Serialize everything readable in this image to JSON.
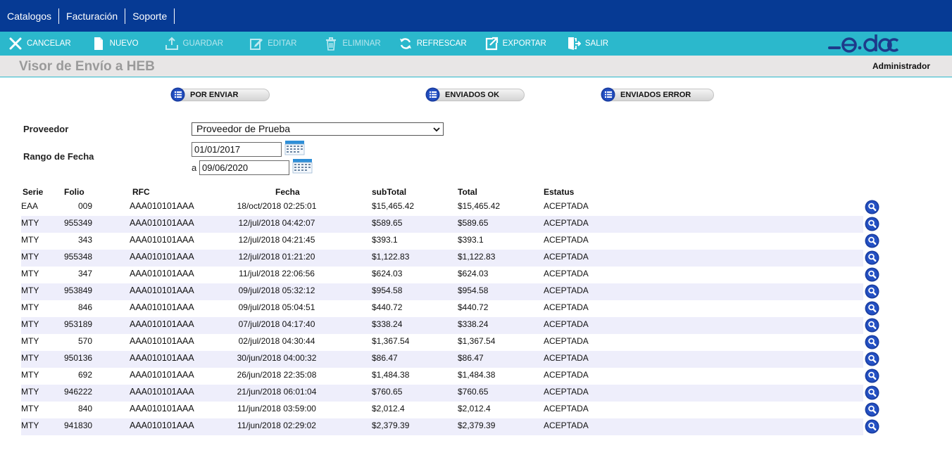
{
  "topnav": {
    "items": [
      {
        "label": "Catalogos"
      },
      {
        "label": "Facturación"
      },
      {
        "label": "Soporte"
      }
    ]
  },
  "toolbar": {
    "cancel_label": "CANCELAR",
    "new_label": "NUEVO",
    "save_label": "GUARDAR",
    "edit_label": "EDITAR",
    "delete_label": "ELIMINAR",
    "refresh_label": "REFRESCAR",
    "export_label": "EXPORTAR",
    "exit_label": "SALIR",
    "logo_text": "e·doc",
    "accent_color": "#2bb8cc",
    "nav_color": "#063a94"
  },
  "header": {
    "title": "Visor de Envío a HEB",
    "user": "Administrador"
  },
  "status_tabs": {
    "pending": "POR ENVIAR",
    "sent_ok": "ENVIADOS OK",
    "sent_error": "ENVIADOS ERROR"
  },
  "filters": {
    "provider_label": "Proveedor",
    "provider_value": "Proveedor de Prueba",
    "date_range_label": "Rango de Fecha",
    "date_from": "01/01/2017",
    "date_to_prefix": "a",
    "date_to": "09/06/2020"
  },
  "table": {
    "headers": {
      "serie": "Serie",
      "folio": "Folio",
      "rfc": "RFC",
      "fecha": "Fecha",
      "subtotal": "subTotal",
      "total": "Total",
      "estatus": "Estatus"
    },
    "rows": [
      {
        "serie": "EAA",
        "folio": "009",
        "rfc": "AAA010101AAA",
        "fecha": "18/oct/2018 02:25:01",
        "subtotal": "$15,465.42",
        "total": "$15,465.42",
        "estatus": "ACEPTADA"
      },
      {
        "serie": "MTY",
        "folio": "955349",
        "rfc": "AAA010101AAA",
        "fecha": "12/jul/2018 04:42:07",
        "subtotal": "$589.65",
        "total": "$589.65",
        "estatus": "ACEPTADA"
      },
      {
        "serie": "MTY",
        "folio": "343",
        "rfc": "AAA010101AAA",
        "fecha": "12/jul/2018 04:21:45",
        "subtotal": "$393.1",
        "total": "$393.1",
        "estatus": "ACEPTADA"
      },
      {
        "serie": "MTY",
        "folio": "955348",
        "rfc": "AAA010101AAA",
        "fecha": "12/jul/2018 01:21:20",
        "subtotal": "$1,122.83",
        "total": "$1,122.83",
        "estatus": "ACEPTADA"
      },
      {
        "serie": "MTY",
        "folio": "347",
        "rfc": "AAA010101AAA",
        "fecha": "11/jul/2018 22:06:56",
        "subtotal": "$624.03",
        "total": "$624.03",
        "estatus": "ACEPTADA"
      },
      {
        "serie": "MTY",
        "folio": "953849",
        "rfc": "AAA010101AAA",
        "fecha": "09/jul/2018 05:32:12",
        "subtotal": "$954.58",
        "total": "$954.58",
        "estatus": "ACEPTADA"
      },
      {
        "serie": "MTY",
        "folio": "846",
        "rfc": "AAA010101AAA",
        "fecha": "09/jul/2018 05:04:51",
        "subtotal": "$440.72",
        "total": "$440.72",
        "estatus": "ACEPTADA"
      },
      {
        "serie": "MTY",
        "folio": "953189",
        "rfc": "AAA010101AAA",
        "fecha": "07/jul/2018 04:17:40",
        "subtotal": "$338.24",
        "total": "$338.24",
        "estatus": "ACEPTADA"
      },
      {
        "serie": "MTY",
        "folio": "570",
        "rfc": "AAA010101AAA",
        "fecha": "02/jul/2018 04:30:44",
        "subtotal": "$1,367.54",
        "total": "$1,367.54",
        "estatus": "ACEPTADA"
      },
      {
        "serie": "MTY",
        "folio": "950136",
        "rfc": "AAA010101AAA",
        "fecha": "30/jun/2018 04:00:32",
        "subtotal": "$86.47",
        "total": "$86.47",
        "estatus": "ACEPTADA"
      },
      {
        "serie": "MTY",
        "folio": "692",
        "rfc": "AAA010101AAA",
        "fecha": "26/jun/2018 22:35:08",
        "subtotal": "$1,484.38",
        "total": "$1,484.38",
        "estatus": "ACEPTADA"
      },
      {
        "serie": "MTY",
        "folio": "946222",
        "rfc": "AAA010101AAA",
        "fecha": "21/jun/2018 06:01:04",
        "subtotal": "$760.65",
        "total": "$760.65",
        "estatus": "ACEPTADA"
      },
      {
        "serie": "MTY",
        "folio": "840",
        "rfc": "AAA010101AAA",
        "fecha": "11/jun/2018 03:59:00",
        "subtotal": "$2,012.4",
        "total": "$2,012.4",
        "estatus": "ACEPTADA"
      },
      {
        "serie": "MTY",
        "folio": "941830",
        "rfc": "AAA010101AAA",
        "fecha": "11/jun/2018 02:29:02",
        "subtotal": "$2,379.39",
        "total": "$2,379.39",
        "estatus": "ACEPTADA"
      }
    ]
  }
}
